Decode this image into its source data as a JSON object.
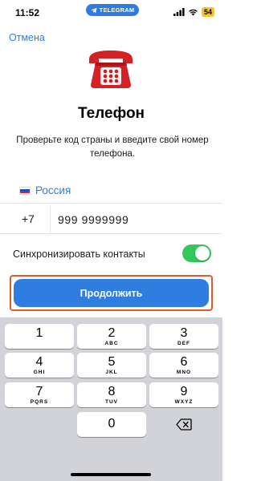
{
  "status_bar": {
    "time": "11:52",
    "app_pill": "TELEGRAM",
    "battery": "54",
    "signal_icon": "signal-icon",
    "wifi_icon": "wifi-icon"
  },
  "nav": {
    "cancel_label": "Отмена"
  },
  "header": {
    "icon": "telephone-emoji",
    "title": "Телефон",
    "subtitle": "Проверьте код страны и введите свой номер телефона."
  },
  "form": {
    "country": "Россия",
    "country_flag": "russia-flag",
    "country_code": "+7",
    "phone_value": "999 9999999"
  },
  "sync": {
    "label": "Синхронизировать контакты",
    "enabled": true
  },
  "continue_label": "Продолжить",
  "keyboard": {
    "keys": [
      {
        "digit": "1",
        "letters": ""
      },
      {
        "digit": "2",
        "letters": "ABC"
      },
      {
        "digit": "3",
        "letters": "DEF"
      },
      {
        "digit": "4",
        "letters": "GHI"
      },
      {
        "digit": "5",
        "letters": "JKL"
      },
      {
        "digit": "6",
        "letters": "MNO"
      },
      {
        "digit": "7",
        "letters": "PQRS"
      },
      {
        "digit": "8",
        "letters": "TUV"
      },
      {
        "digit": "9",
        "letters": "WXYZ"
      },
      {
        "digit": "0",
        "letters": ""
      }
    ],
    "backspace_icon": "backspace-icon"
  },
  "colors": {
    "accent": "#2f7de1",
    "toggle_on": "#34c759",
    "highlight_outline": "#e05a2c",
    "keyboard_bg": "#d1d3d9"
  }
}
